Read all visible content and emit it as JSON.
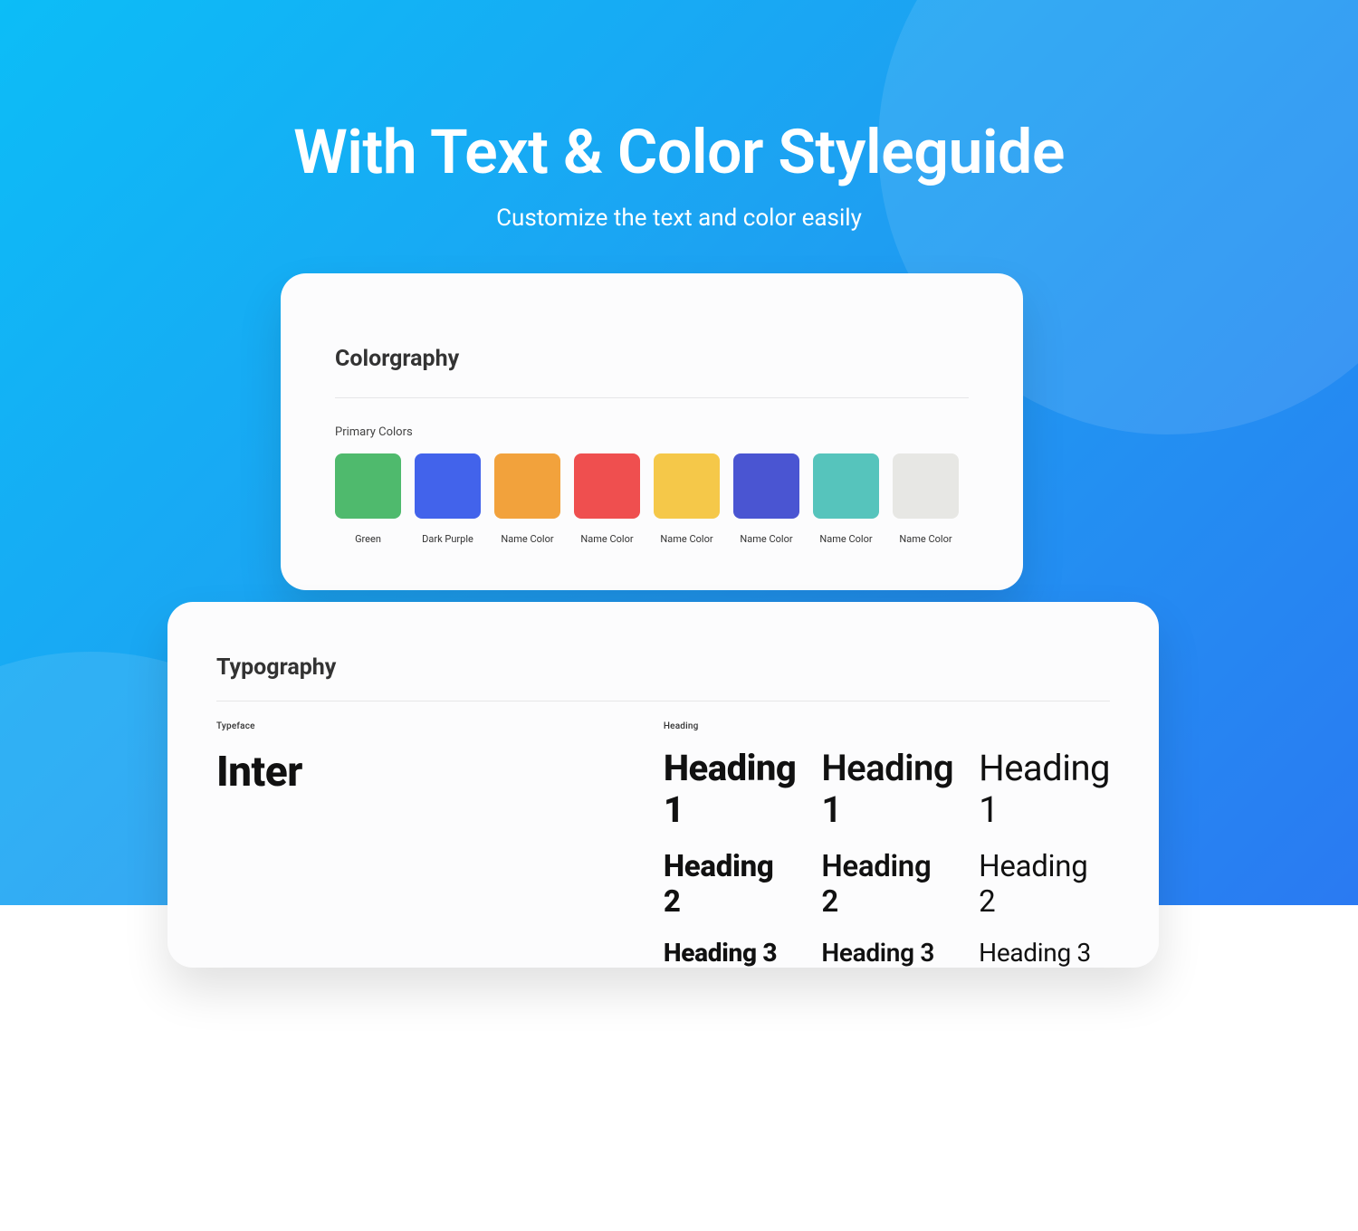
{
  "hero": {
    "title": "With Text & Color Styleguide",
    "subtitle": "Customize the text and color easily"
  },
  "colors_card": {
    "title": "Colorgraphy",
    "section_label": "Primary Colors",
    "swatches": [
      {
        "label": "Green",
        "hex": "#4fba6d"
      },
      {
        "label": "Dark Purple",
        "hex": "#4263eb"
      },
      {
        "label": "Name Color",
        "hex": "#f2a23c"
      },
      {
        "label": "Name Color",
        "hex": "#ef4f4f"
      },
      {
        "label": "Name Color",
        "hex": "#f5c849"
      },
      {
        "label": "Name Color",
        "hex": "#4a55d2"
      },
      {
        "label": "Name Color",
        "hex": "#56c4bc"
      },
      {
        "label": "Name Color",
        "hex": "#e7e7e4"
      }
    ]
  },
  "typo_card": {
    "title": "Typography",
    "typeface_label": "Typeface",
    "typeface_name": "Inter",
    "heading_label": "Heading",
    "headings": {
      "h1": "Heading 1",
      "h2": "Heading 2",
      "h3": "Heading 3"
    }
  }
}
